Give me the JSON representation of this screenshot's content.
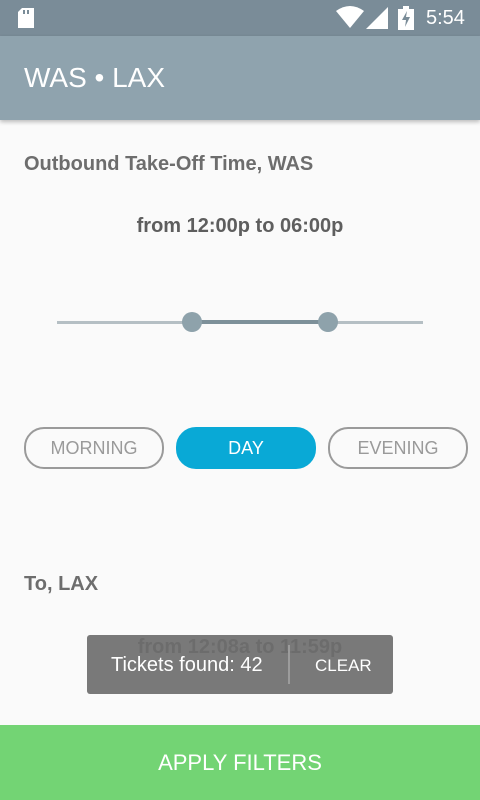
{
  "status_bar": {
    "time": "5:54",
    "icons": [
      "sd-card-icon",
      "wifi-icon",
      "signal-icon",
      "battery-charging-icon"
    ]
  },
  "app_bar": {
    "title": "WAS • LAX"
  },
  "outbound": {
    "heading": "Outbound Take-Off Time, WAS",
    "range_text": "from 12:00p to 06:00p",
    "slider": {
      "min_value": 0.37,
      "max_value": 0.74
    },
    "presets": [
      {
        "label": "MORNING",
        "selected": false
      },
      {
        "label": "DAY",
        "selected": true
      },
      {
        "label": "EVENING",
        "selected": false
      }
    ]
  },
  "return": {
    "heading": "To, LAX",
    "range_text": "from 12:08a to 11:59p"
  },
  "toast": {
    "message": "Tickets found: 42",
    "action": "CLEAR"
  },
  "apply_button": {
    "label": "APPLY FILTERS"
  },
  "colors": {
    "status_bar": "#7a8c98",
    "app_bar": "#8fa3ae",
    "accent_selected": "#09a9d6",
    "apply_green": "#73d474",
    "slider_thumb": "#8ea2ab"
  }
}
